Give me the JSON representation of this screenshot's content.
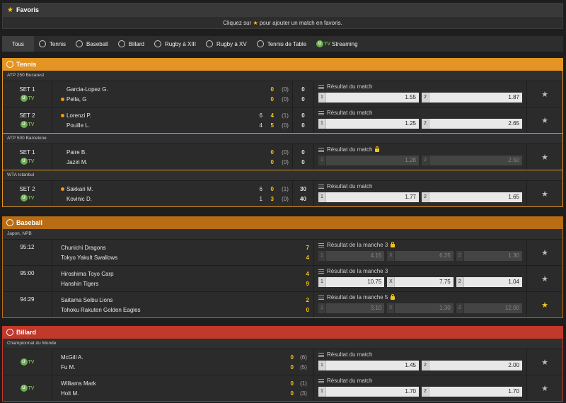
{
  "favorites": {
    "title": "Favoris",
    "message_pre": "Cliquez sur ",
    "message_post": " pour ajouter un match en favoris."
  },
  "tabs": [
    {
      "label": "Tous",
      "icon": "none"
    },
    {
      "label": "Tennis",
      "icon": "tennis-ball-icon"
    },
    {
      "label": "Baseball",
      "icon": "baseball-icon"
    },
    {
      "label": "Billard",
      "icon": "billiard-ball-icon"
    },
    {
      "label": "Rugby à XIII",
      "icon": "rugby-ball-icon"
    },
    {
      "label": "Rugby à XV",
      "icon": "rugby-ball-icon"
    },
    {
      "label": "Tennis de Table",
      "icon": "ping-pong-icon"
    },
    {
      "label": "Streaming",
      "icon": "utv-icon"
    }
  ],
  "tv": {
    "u": "U",
    "t": "TV"
  },
  "tennis": {
    "title": "Tennis",
    "color": "#e39422",
    "groups": [
      {
        "name": "ATP 250 Bucarest",
        "matches": [
          {
            "status": "SET 1",
            "tv": true,
            "p1": "Garcia-Lopez G.",
            "p2": "Pella, G",
            "serve": 2,
            "s1a": "",
            "s1b": "0",
            "p1p": "(0)",
            "t1": "0",
            "s2a": "",
            "s2b": "0",
            "p2p": "(0)",
            "t2": "0",
            "market": "Résultat du match",
            "locked": false,
            "o1": "1.55",
            "o2": "1.87",
            "fav": false
          },
          {
            "status": "SET 2",
            "tv": true,
            "p1": "Lorenzi P.",
            "p2": "Pouille L.",
            "serve": 1,
            "s1a": "6",
            "s1b": "4",
            "p1p": "(1)",
            "t1": "0",
            "s2a": "4",
            "s2b": "5",
            "p2p": "(0)",
            "t2": "0",
            "market": "Résultat du match",
            "locked": false,
            "o1": "1.25",
            "o2": "2.65",
            "fav": false
          }
        ]
      },
      {
        "name": "ATP 500 Barcelone",
        "matches": [
          {
            "status": "SET 1",
            "tv": true,
            "p1": "Paire B.",
            "p2": "Jaziri M.",
            "serve": 0,
            "s1a": "",
            "s1b": "0",
            "p1p": "(0)",
            "t1": "0",
            "s2a": "",
            "s2b": "0",
            "p2p": "(0)",
            "t2": "0",
            "market": "Résultat du match",
            "locked": true,
            "o1": "1.28",
            "o2": "2.50",
            "fav": false
          }
        ]
      },
      {
        "name": "WTA Istanbul",
        "matches": [
          {
            "status": "SET 2",
            "tv": true,
            "p1": "Sakkari M.",
            "p2": "Kovinic D.",
            "serve": 1,
            "s1a": "6",
            "s1b": "0",
            "p1p": "(1)",
            "t1": "30",
            "s2a": "1",
            "s2b": "3",
            "p2p": "(0)",
            "t2": "40",
            "market": "Résultat du match",
            "locked": false,
            "o1": "1.77",
            "o2": "1.65",
            "fav": false
          }
        ]
      }
    ]
  },
  "baseball": {
    "title": "Baseball",
    "color": "#b86c14",
    "group": "Japon, NPB",
    "matches": [
      {
        "status": "95:12",
        "p1": "Chunichi Dragons",
        "p2": "Tokyo Yakult Swallows",
        "s1": "7",
        "s2": "4",
        "market": "Résultat de la manche 3",
        "locked": true,
        "o1": "4.15",
        "ox": "6.25",
        "o2": "1.30",
        "fav": false
      },
      {
        "status": "95:00",
        "p1": "Hiroshima Toyo Carp",
        "p2": "Hanshin Tigers",
        "s1": "4",
        "s2": "9",
        "market": "Résultat de la manche 3",
        "locked": false,
        "o1": "10.75",
        "ox": "7.75",
        "o2": "1.04",
        "fav": false
      },
      {
        "status": "94:29",
        "p1": "Saitama Seibu Lions",
        "p2": "Tohoku Rakuten Golden Eagles",
        "s1": "2",
        "s2": "0",
        "market": "Résultat de la manche 5",
        "locked": true,
        "o1": "3.10",
        "ox": "1.30",
        "o2": "12.00",
        "fav": true
      }
    ]
  },
  "billard": {
    "title": "Billard",
    "color": "#c0392b",
    "group": "Championnat du Monde",
    "matches": [
      {
        "p1": "McGill A.",
        "p2": "Fu M.",
        "s1": "0",
        "s2": "0",
        "p1p": "(6)",
        "p2p": "(5)",
        "market": "Résultat du match",
        "locked": false,
        "o1": "1.45",
        "o2": "2.00",
        "fav": false
      },
      {
        "p1": "Williams Mark",
        "p2": "Holt M.",
        "s1": "0",
        "s2": "0",
        "p1p": "(1)",
        "p2p": "(3)",
        "market": "Résultat du match",
        "locked": false,
        "o1": "1.70",
        "o2": "1.70",
        "fav": false
      }
    ]
  },
  "labels": {
    "one": "1",
    "two": "2",
    "x": "X"
  }
}
